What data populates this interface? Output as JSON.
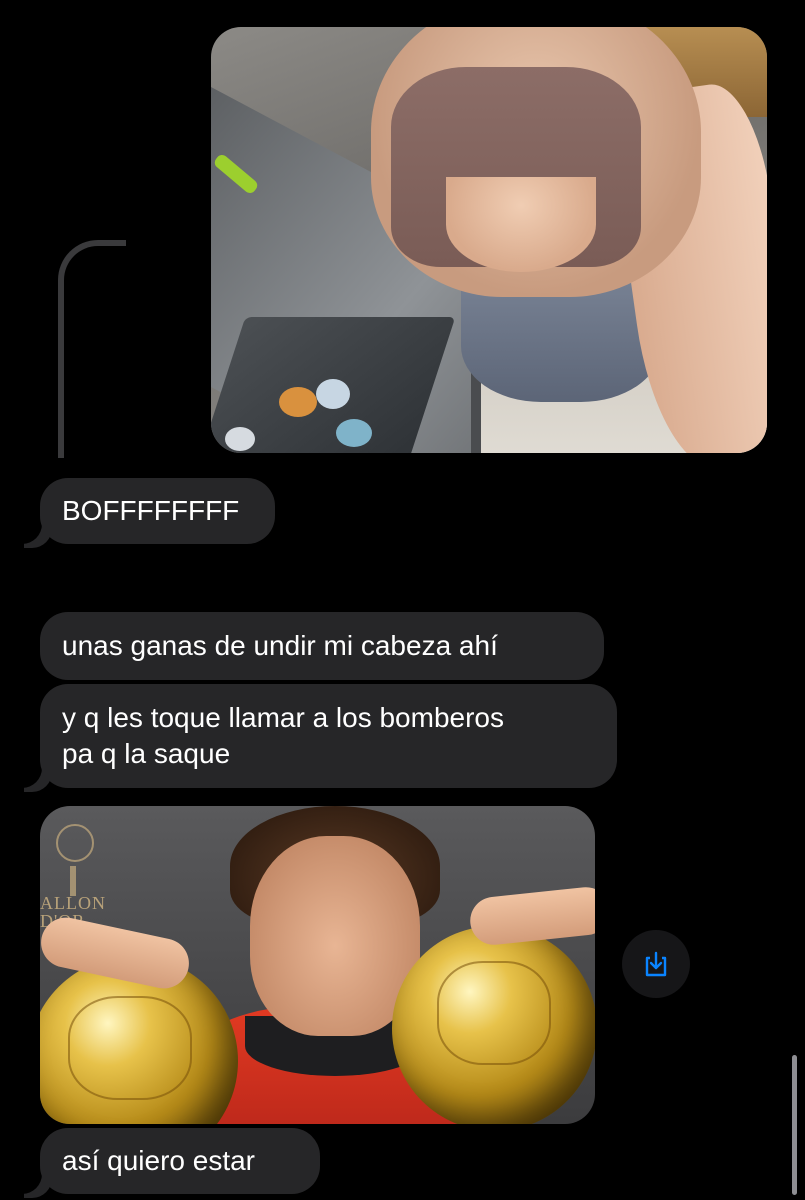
{
  "messages": [
    {
      "id": "img1",
      "type": "image",
      "direction": "outgoing",
      "alt": "photo"
    },
    {
      "id": "m1",
      "type": "text",
      "direction": "incoming",
      "text": "BOFFFFFFFF"
    },
    {
      "id": "m2",
      "type": "text",
      "direction": "incoming",
      "text": "unas ganas de undir mi cabeza ahí"
    },
    {
      "id": "m3",
      "type": "text",
      "direction": "incoming",
      "lines": [
        "y q les toque llamar a los bomberos",
        "pa q la saque"
      ]
    },
    {
      "id": "img2",
      "type": "image",
      "direction": "incoming",
      "alt": "photo",
      "watermark": [
        "ALLON",
        "D'OR"
      ]
    },
    {
      "id": "m4",
      "type": "text",
      "direction": "incoming",
      "text": "así quiero estar"
    }
  ],
  "save_button": {
    "icon": "save-download-icon",
    "color": "#0a84ff"
  },
  "colors": {
    "background": "#000000",
    "incoming_bubble": "#262628",
    "text": "#ffffff",
    "reply_line": "#3a3a3c",
    "accent": "#0a84ff"
  }
}
